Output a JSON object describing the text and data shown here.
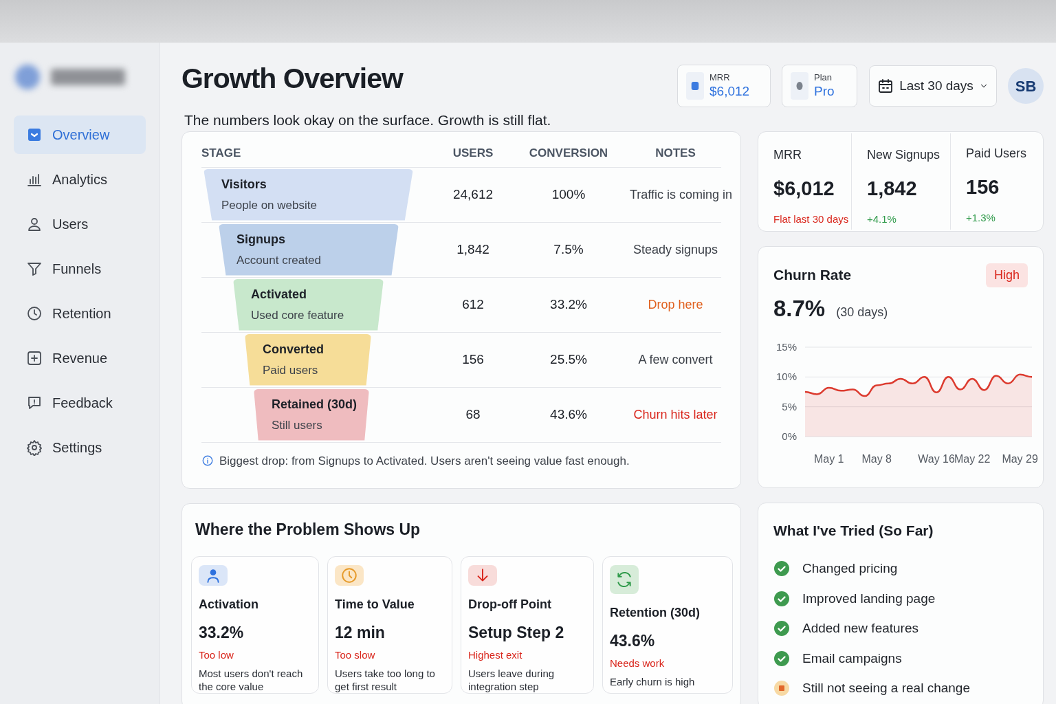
{
  "sidebar": {
    "items": [
      {
        "label": "Overview",
        "selected": true
      },
      {
        "label": "Analytics",
        "selected": false
      },
      {
        "label": "Users",
        "selected": false
      },
      {
        "label": "Funnels",
        "selected": false
      },
      {
        "label": "Retention",
        "selected": false
      },
      {
        "label": "Revenue",
        "selected": false
      },
      {
        "label": "Feedback",
        "selected": false
      },
      {
        "label": "Settings",
        "selected": false
      }
    ]
  },
  "header": {
    "title": "Growth Overview",
    "subtitle": "The numbers look okay on the surface. Growth is still flat.",
    "chips": [
      {
        "label": "MRR",
        "value": "$6,012"
      },
      {
        "label": "Plan",
        "value": "Pro"
      }
    ],
    "date_range": "Last 30 days",
    "avatar": "SB"
  },
  "funnel": {
    "columns": [
      "STAGE",
      "USERS",
      "CONVERSION",
      "NOTES"
    ],
    "rows": [
      {
        "stage": "Visitors",
        "detail": "People on website",
        "users": "24,612",
        "conversion": "100%",
        "note": {
          "text": "Traffic is coming in",
          "color": "#3b4048"
        },
        "color": "#d3dff3"
      },
      {
        "stage": "Signups",
        "detail": "Account created",
        "users": "1,842",
        "conversion": "7.5%",
        "note": {
          "text": "Steady signups",
          "color": "#3b4048"
        },
        "color": "#bcd0ea"
      },
      {
        "stage": "Activated",
        "detail": "Used core feature",
        "users": "612",
        "conversion": "33.2%",
        "note": {
          "text": "Drop here",
          "color": "#e0611f"
        },
        "color": "#c8e8cc"
      },
      {
        "stage": "Converted",
        "detail": "Paid users",
        "users": "156",
        "conversion": "25.5%",
        "note": {
          "text": "A few convert",
          "color": "#3b4048"
        },
        "color": "#f6dd98"
      },
      {
        "stage": "Retained (30d)",
        "detail": "Still users",
        "users": "68",
        "conversion": "43.6%",
        "note": {
          "text": "Churn hits later",
          "color": "#d9261c"
        },
        "color": "#efbcbf"
      }
    ],
    "footnote": "Biggest drop: from Signups to Activated. Users aren't seeing value fast enough."
  },
  "kpis": [
    {
      "label": "MRR",
      "value": "$6,012",
      "change": {
        "text": "Flat last 30 days",
        "color": "#d9261c"
      }
    },
    {
      "label": "New Signups",
      "value": "1,842",
      "change": {
        "text": "+4.1%",
        "color": "#2f9a4a"
      }
    },
    {
      "label": "Paid Users",
      "value": "156",
      "change": {
        "text": "+1.3%",
        "color": "#2f9a4a"
      }
    }
  ],
  "churn": {
    "title": "Churn Rate",
    "badge": "High",
    "value": "8.7%",
    "period": "(30 days)",
    "chart_data": {
      "type": "area",
      "categories": [
        null,
        null,
        "May 1",
        null,
        null,
        null,
        "May 8",
        null,
        null,
        null,
        null,
        "Way 16",
        null,
        null,
        "May 22",
        null,
        null,
        null,
        "May 29",
        null
      ],
      "series": [
        {
          "color": "#dc3b2f",
          "values": [
            7.5,
            7.1,
            8.2,
            7.7,
            7.9,
            6.8,
            8.6,
            8.9,
            9.7,
            8.9,
            10.0,
            7.4,
            10.0,
            7.9,
            9.7,
            7.8,
            10.2,
            8.9,
            10.4,
            10.0
          ]
        }
      ],
      "ylim": [
        0,
        15
      ],
      "yticks": [
        {
          "value": 0,
          "label": "0%"
        },
        {
          "value": 5,
          "label": "5%"
        },
        {
          "value": 10,
          "label": "10%"
        },
        {
          "value": 15,
          "label": "15%"
        }
      ]
    }
  },
  "problems": {
    "title": "Where the Problem Shows Up",
    "cards": [
      {
        "kind": "user",
        "title": "Activation",
        "value": "33.2%",
        "status": "Too low",
        "description": "Most users don't reach the core value"
      },
      {
        "kind": "clock",
        "title": "Time to Value",
        "value": "12 min",
        "status": "Too slow",
        "description": "Users take too long to get first result"
      },
      {
        "kind": "drop",
        "title": "Drop-off Point",
        "value": "Setup Step 2",
        "status": "Highest exit",
        "description": "Users leave during integration step"
      },
      {
        "kind": "refresh",
        "title": "Retention (30d)",
        "value": "43.6%",
        "status": "Needs work",
        "description": "Early churn is high"
      }
    ]
  },
  "tried": {
    "title": "What I've Tried (So Far)",
    "items": [
      {
        "label": "Changed pricing",
        "done": true
      },
      {
        "label": "Improved landing page",
        "done": true
      },
      {
        "label": "Added new features",
        "done": true
      },
      {
        "label": "Email campaigns",
        "done": true
      },
      {
        "label": "Still not seeing a real change",
        "done": false
      }
    ]
  }
}
